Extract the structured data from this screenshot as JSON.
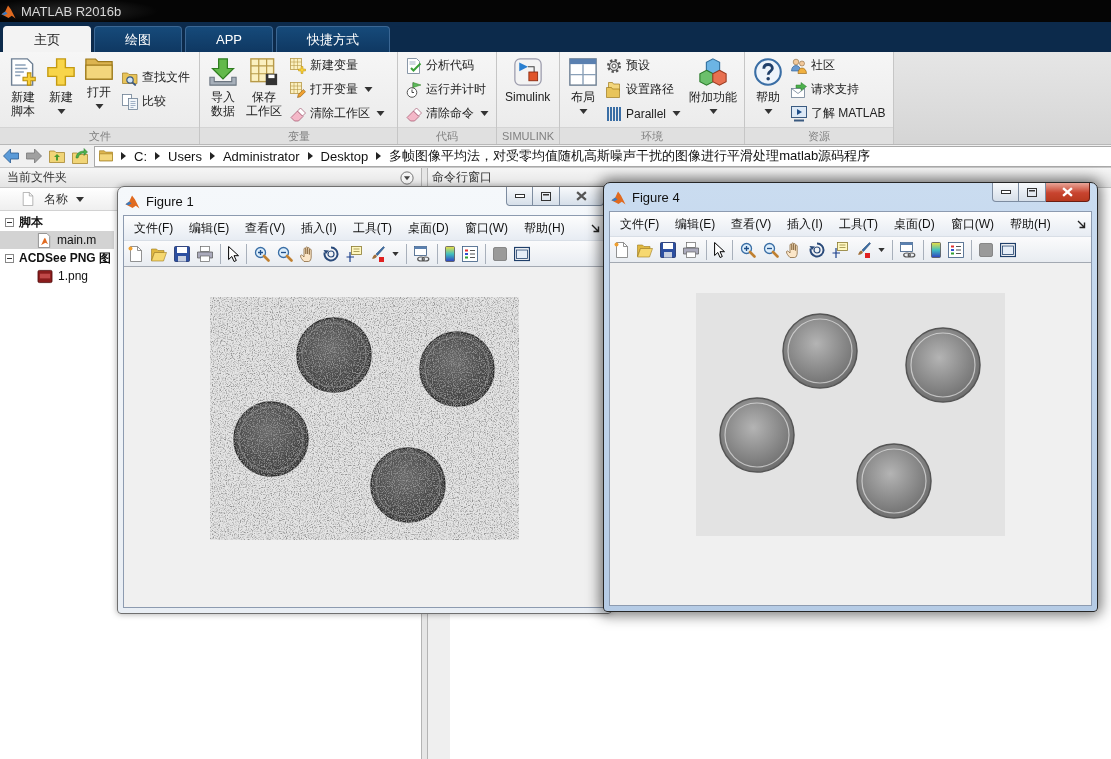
{
  "window": {
    "title": "MATLAB R2016b"
  },
  "tabs": [
    {
      "label": "主页",
      "selected": true
    },
    {
      "label": "绘图",
      "selected": false
    },
    {
      "label": "APP",
      "selected": false
    },
    {
      "label": "快捷方式",
      "selected": false
    }
  ],
  "ribbon": {
    "sections": [
      {
        "label": "文件",
        "items": [
          {
            "kind": "large",
            "lines": [
              "新建",
              "脚本"
            ],
            "dropdown": false
          },
          {
            "kind": "large",
            "lines": [
              "新建"
            ],
            "dropdown": true
          },
          {
            "kind": "large",
            "lines": [
              "打开"
            ],
            "dropdown": true
          },
          {
            "kind": "stack",
            "buttons": [
              {
                "label": "查找文件",
                "dropdown": false
              },
              {
                "label": "比较",
                "dropdown": false
              }
            ]
          }
        ]
      },
      {
        "label": "变量",
        "items": [
          {
            "kind": "large",
            "lines": [
              "导入",
              "数据"
            ],
            "dropdown": false
          },
          {
            "kind": "large",
            "lines": [
              "保存",
              "工作区"
            ],
            "dropdown": false
          },
          {
            "kind": "stack",
            "buttons": [
              {
                "label": "新建变量",
                "dropdown": false
              },
              {
                "label": "打开变量",
                "dropdown": true
              },
              {
                "label": "清除工作区",
                "dropdown": true
              }
            ]
          }
        ]
      },
      {
        "label": "代码",
        "items": [
          {
            "kind": "stack",
            "buttons": [
              {
                "label": "分析代码",
                "dropdown": false
              },
              {
                "label": "运行并计时",
                "dropdown": false
              },
              {
                "label": "清除命令",
                "dropdown": true
              }
            ]
          }
        ]
      },
      {
        "label": "SIMULINK",
        "items": [
          {
            "kind": "large",
            "lines": [
              "Simulink"
            ],
            "dropdown": false
          }
        ]
      },
      {
        "label": "环境",
        "items": [
          {
            "kind": "large",
            "lines": [
              "布局"
            ],
            "dropdown": true
          },
          {
            "kind": "stack",
            "buttons": [
              {
                "label": "预设",
                "dropdown": false
              },
              {
                "label": "设置路径",
                "dropdown": false
              },
              {
                "label": "Parallel",
                "dropdown": true
              }
            ]
          },
          {
            "kind": "large",
            "lines": [
              "附加功能"
            ],
            "dropdown": true
          }
        ]
      },
      {
        "label": "资源",
        "items": [
          {
            "kind": "large",
            "lines": [
              "帮助"
            ],
            "dropdown": true
          },
          {
            "kind": "stack",
            "buttons": [
              {
                "label": "社区",
                "dropdown": false
              },
              {
                "label": "请求支持",
                "dropdown": false
              },
              {
                "label": "了解 MATLAB",
                "dropdown": false
              }
            ]
          }
        ]
      }
    ]
  },
  "address": {
    "segments": [
      "C:",
      "Users",
      "Administrator",
      "Desktop",
      "多帧图像平均法，对受零均值随机高斯噪声干扰的图像进行平滑处理matlab源码程序"
    ]
  },
  "current_folder": {
    "title": "当前文件夹",
    "column": "名称",
    "tree": [
      {
        "label": "脚本",
        "expanded": true,
        "selected": false,
        "children": [
          {
            "label": "main.m",
            "kind": "script",
            "selected": true
          }
        ]
      },
      {
        "label": "ACDSee PNG 图",
        "expanded": true,
        "selected": false,
        "children": [
          {
            "label": "1.png",
            "kind": "image",
            "selected": false
          }
        ]
      }
    ]
  },
  "command_window": {
    "title": "命令行窗口"
  },
  "figures": [
    {
      "title": "Figure 1",
      "active": false,
      "noisy": true,
      "menu": [
        "文件(F)",
        "编辑(E)",
        "查看(V)",
        "插入(I)",
        "工具(T)",
        "桌面(D)",
        "窗口(W)",
        "帮助(H)"
      ]
    },
    {
      "title": "Figure 4",
      "active": true,
      "noisy": false,
      "menu": [
        "文件(F)",
        "编辑(E)",
        "查看(V)",
        "插入(I)",
        "工具(T)",
        "桌面(D)",
        "窗口(W)",
        "帮助(H)"
      ]
    }
  ]
}
